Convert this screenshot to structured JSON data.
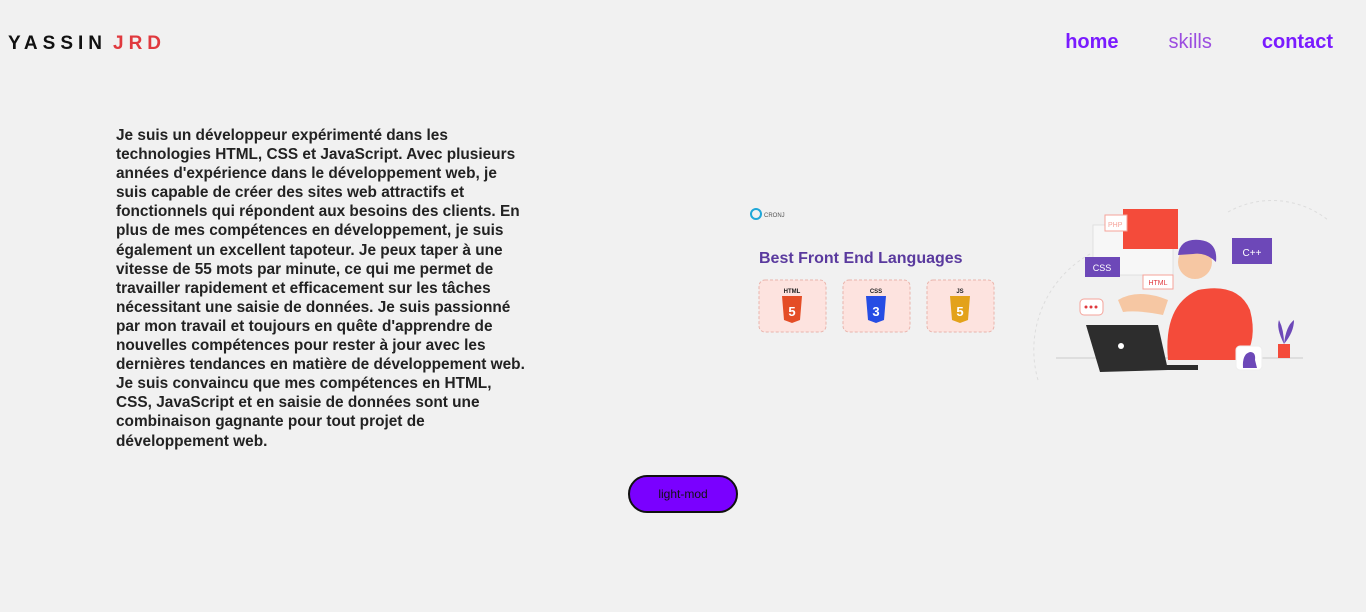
{
  "header": {
    "brand_first": "YASSIN",
    "brand_last": "JRD",
    "nav": [
      {
        "label": "home"
      },
      {
        "label": "skills"
      },
      {
        "label": "contact"
      }
    ]
  },
  "main": {
    "about_text": "Je suis un développeur expérimenté dans les technologies HTML, CSS et JavaScript. Avec plusieurs années d'expérience dans le développement web, je suis capable de créer des sites web attractifs et fonctionnels qui répondent aux besoins des clients. En plus de mes compétences en développement, je suis également un excellent tapoteur. Je peux taper à une vitesse de 55 mots par minute, ce qui me permet de travailler rapidement et efficacement sur les tâches nécessitant une saisie de données. Je suis passionné par mon travail et toujours en quête d'apprendre de nouvelles compétences pour rester à jour avec les dernières tendances en matière de développement web. Je suis convaincu que mes compétences en HTML, CSS, JavaScript et en saisie de données sont une combinaison gagnante pour tout projet de développement web."
  },
  "figure": {
    "logo_text": "CRONJ",
    "heading": "Best Front End Languages",
    "badges": [
      {
        "label": "HTML",
        "number": "5",
        "color": "#e44d26"
      },
      {
        "label": "CSS",
        "number": "3",
        "color": "#264de4"
      },
      {
        "label": "JS",
        "number": "5",
        "color": "#e3a21a"
      }
    ],
    "tags": {
      "css": "CSS",
      "cpp": "C++",
      "html": "HTML",
      "php": "PHP"
    }
  },
  "toggle": {
    "label": "light-mod"
  },
  "colors": {
    "accent": "#7a00ff",
    "brand_accent": "#e0393e",
    "nav": "#7a1bff"
  }
}
